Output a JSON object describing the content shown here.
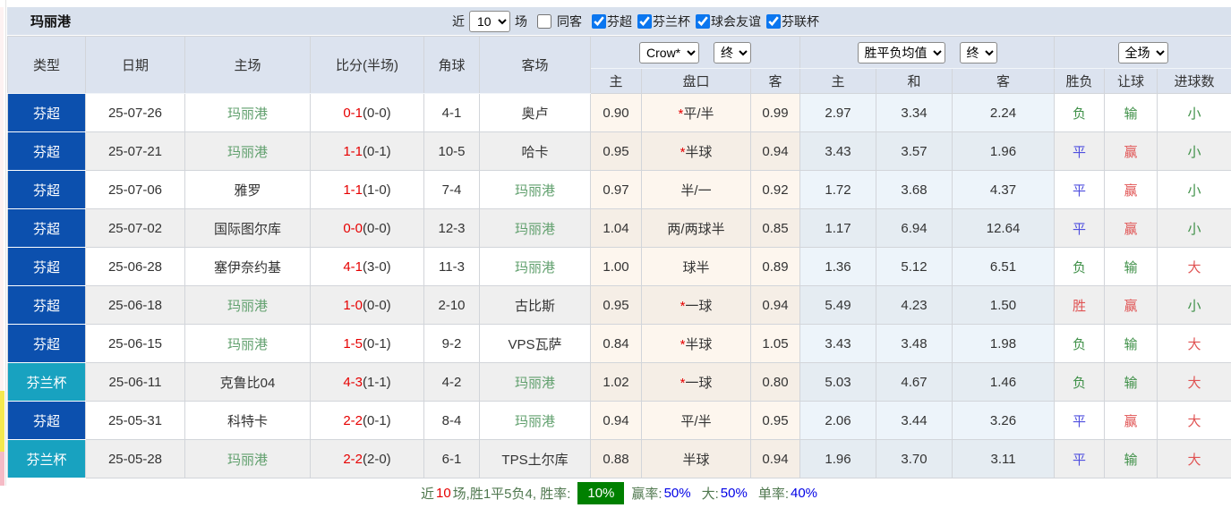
{
  "colors": {
    "league_super": "#0C50AE",
    "league_cup": "#18A2C0",
    "highlight_team": "#61A06E",
    "win_red": "#E05353",
    "draw_blue": "#4F4FDF",
    "loss_green": "#3F9048",
    "score_red": "#E60000",
    "badge_green": "#008000",
    "header_bg": "#DCE3EF"
  },
  "toolbar": {
    "title": "玛丽港",
    "recent_label": "近",
    "recent_value": "10",
    "matches_label": "场",
    "same_opponent": {
      "label": "同客",
      "checked": false
    },
    "filters": [
      {
        "label": "芬超",
        "checked": true
      },
      {
        "label": "芬兰杯",
        "checked": true
      },
      {
        "label": "球会友谊",
        "checked": true
      },
      {
        "label": "芬联杯",
        "checked": true
      }
    ]
  },
  "table": {
    "static_headers": [
      "类型",
      "日期",
      "主场",
      "比分(半场)",
      "角球",
      "客场"
    ],
    "group_selects": {
      "odds_company": "Crow*",
      "odds_time": "终",
      "avg_label": "胜平负均值",
      "avg_time": "终",
      "scope": "全场"
    },
    "sub_headers": [
      "主",
      "盘口",
      "客",
      "主",
      "和",
      "客",
      "胜负",
      "让球",
      "进球数"
    ],
    "rows": [
      {
        "league": "芬超",
        "date": "25-07-26",
        "home": "玛丽港",
        "home_hl": true,
        "score": "0-1",
        "half": "(0-0)",
        "corner": "4-1",
        "away": "奥卢",
        "away_hl": false,
        "o_home": "0.90",
        "handicap": "平/半",
        "handicap_star": true,
        "o_away": "0.99",
        "avg_win": "2.97",
        "avg_draw": "3.34",
        "avg_lose": "2.24",
        "result": "负",
        "result_c": "green",
        "ah": "输",
        "ah_c": "green",
        "goals": "小",
        "goals_c": "green"
      },
      {
        "league": "芬超",
        "date": "25-07-21",
        "home": "玛丽港",
        "home_hl": true,
        "score": "1-1",
        "half": "(0-1)",
        "corner": "10-5",
        "away": "哈卡",
        "away_hl": false,
        "o_home": "0.95",
        "handicap": "半球",
        "handicap_star": true,
        "o_away": "0.94",
        "avg_win": "3.43",
        "avg_draw": "3.57",
        "avg_lose": "1.96",
        "result": "平",
        "result_c": "blue",
        "ah": "赢",
        "ah_c": "red",
        "goals": "小",
        "goals_c": "green"
      },
      {
        "league": "芬超",
        "date": "25-07-06",
        "home": "雅罗",
        "home_hl": false,
        "score": "1-1",
        "half": "(1-0)",
        "corner": "7-4",
        "away": "玛丽港",
        "away_hl": true,
        "o_home": "0.97",
        "handicap": "半/一",
        "handicap_star": false,
        "o_away": "0.92",
        "avg_win": "1.72",
        "avg_draw": "3.68",
        "avg_lose": "4.37",
        "result": "平",
        "result_c": "blue",
        "ah": "赢",
        "ah_c": "red",
        "goals": "小",
        "goals_c": "green"
      },
      {
        "league": "芬超",
        "date": "25-07-02",
        "home": "国际图尔库",
        "home_hl": false,
        "score": "0-0",
        "half": "(0-0)",
        "corner": "12-3",
        "away": "玛丽港",
        "away_hl": true,
        "o_home": "1.04",
        "handicap": "两/两球半",
        "handicap_star": false,
        "o_away": "0.85",
        "avg_win": "1.17",
        "avg_draw": "6.94",
        "avg_lose": "12.64",
        "result": "平",
        "result_c": "blue",
        "ah": "赢",
        "ah_c": "red",
        "goals": "小",
        "goals_c": "green"
      },
      {
        "league": "芬超",
        "date": "25-06-28",
        "home": "塞伊奈约基",
        "home_hl": false,
        "score": "4-1",
        "half": "(3-0)",
        "corner": "11-3",
        "away": "玛丽港",
        "away_hl": true,
        "o_home": "1.00",
        "handicap": "球半",
        "handicap_star": false,
        "o_away": "0.89",
        "avg_win": "1.36",
        "avg_draw": "5.12",
        "avg_lose": "6.51",
        "result": "负",
        "result_c": "green",
        "ah": "输",
        "ah_c": "green",
        "goals": "大",
        "goals_c": "red"
      },
      {
        "league": "芬超",
        "date": "25-06-18",
        "home": "玛丽港",
        "home_hl": true,
        "score": "1-0",
        "half": "(0-0)",
        "corner": "2-10",
        "away": "古比斯",
        "away_hl": false,
        "o_home": "0.95",
        "handicap": "一球",
        "handicap_star": true,
        "o_away": "0.94",
        "avg_win": "5.49",
        "avg_draw": "4.23",
        "avg_lose": "1.50",
        "result": "胜",
        "result_c": "red",
        "ah": "赢",
        "ah_c": "red",
        "goals": "小",
        "goals_c": "green"
      },
      {
        "league": "芬超",
        "date": "25-06-15",
        "home": "玛丽港",
        "home_hl": true,
        "score": "1-5",
        "half": "(0-1)",
        "corner": "9-2",
        "away": "VPS瓦萨",
        "away_hl": false,
        "o_home": "0.84",
        "handicap": "半球",
        "handicap_star": true,
        "o_away": "1.05",
        "avg_win": "3.43",
        "avg_draw": "3.48",
        "avg_lose": "1.98",
        "result": "负",
        "result_c": "green",
        "ah": "输",
        "ah_c": "green",
        "goals": "大",
        "goals_c": "red"
      },
      {
        "league": "芬兰杯",
        "date": "25-06-11",
        "home": "克鲁比04",
        "home_hl": false,
        "score": "4-3",
        "half": "(1-1)",
        "corner": "4-2",
        "away": "玛丽港",
        "away_hl": true,
        "o_home": "1.02",
        "handicap": "一球",
        "handicap_star": true,
        "o_away": "0.80",
        "avg_win": "5.03",
        "avg_draw": "4.67",
        "avg_lose": "1.46",
        "result": "负",
        "result_c": "green",
        "ah": "输",
        "ah_c": "green",
        "goals": "大",
        "goals_c": "red"
      },
      {
        "league": "芬超",
        "date": "25-05-31",
        "home": "科特卡",
        "home_hl": false,
        "score": "2-2",
        "half": "(0-1)",
        "corner": "8-4",
        "away": "玛丽港",
        "away_hl": true,
        "o_home": "0.94",
        "handicap": "平/半",
        "handicap_star": false,
        "o_away": "0.95",
        "avg_win": "2.06",
        "avg_draw": "3.44",
        "avg_lose": "3.26",
        "result": "平",
        "result_c": "blue",
        "ah": "赢",
        "ah_c": "red",
        "goals": "大",
        "goals_c": "red"
      },
      {
        "league": "芬兰杯",
        "date": "25-05-28",
        "home": "玛丽港",
        "home_hl": true,
        "score": "2-2",
        "half": "(2-0)",
        "corner": "6-1",
        "away": "TPS土尔库",
        "away_hl": false,
        "o_home": "0.88",
        "handicap": "半球",
        "handicap_star": false,
        "o_away": "0.94",
        "avg_win": "1.96",
        "avg_draw": "3.70",
        "avg_lose": "3.11",
        "result": "平",
        "result_c": "blue",
        "ah": "输",
        "ah_c": "green",
        "goals": "大",
        "goals_c": "red"
      }
    ]
  },
  "footer": {
    "prefix": "近",
    "count": "10",
    "summary": "场,胜1平5负4, 胜率:",
    "win_rate": "10%",
    "win_odds_label": "赢率:",
    "win_odds": "50%",
    "big_label": "大:",
    "big": "50%",
    "single_label": "单率:",
    "single": "40%"
  }
}
